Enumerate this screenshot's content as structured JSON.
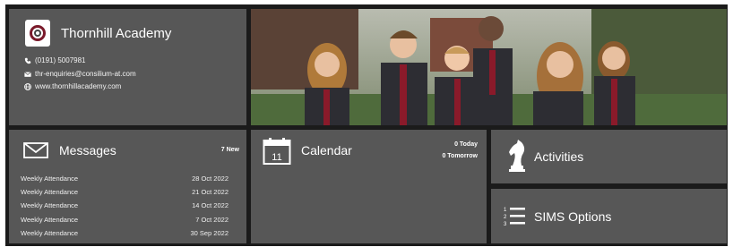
{
  "school": {
    "name": "Thornhill Academy",
    "phone": "(0191) 5007981",
    "email": "thr-enquiries@consilium-at.com",
    "website": "www.thornhillacademy.com"
  },
  "messages": {
    "title": "Messages",
    "new_count": "7 New",
    "items": [
      {
        "subject": "Weekly Attendance",
        "date": "28 Oct 2022"
      },
      {
        "subject": "Weekly Attendance",
        "date": "21 Oct 2022"
      },
      {
        "subject": "Weekly Attendance",
        "date": "14 Oct 2022"
      },
      {
        "subject": "Weekly Attendance",
        "date": "7 Oct 2022"
      },
      {
        "subject": "Weekly Attendance",
        "date": "30 Sep 2022"
      }
    ]
  },
  "calendar": {
    "title": "Calendar",
    "icon_day": "11",
    "today": "0 Today",
    "tomorrow": "0 Tomorrow"
  },
  "activities": {
    "title": "Activities"
  },
  "sims_options": {
    "title": "SIMS Options"
  },
  "colors": {
    "tile": "#575757",
    "background": "#1b1b1b",
    "crest": "#7a1a2b"
  }
}
